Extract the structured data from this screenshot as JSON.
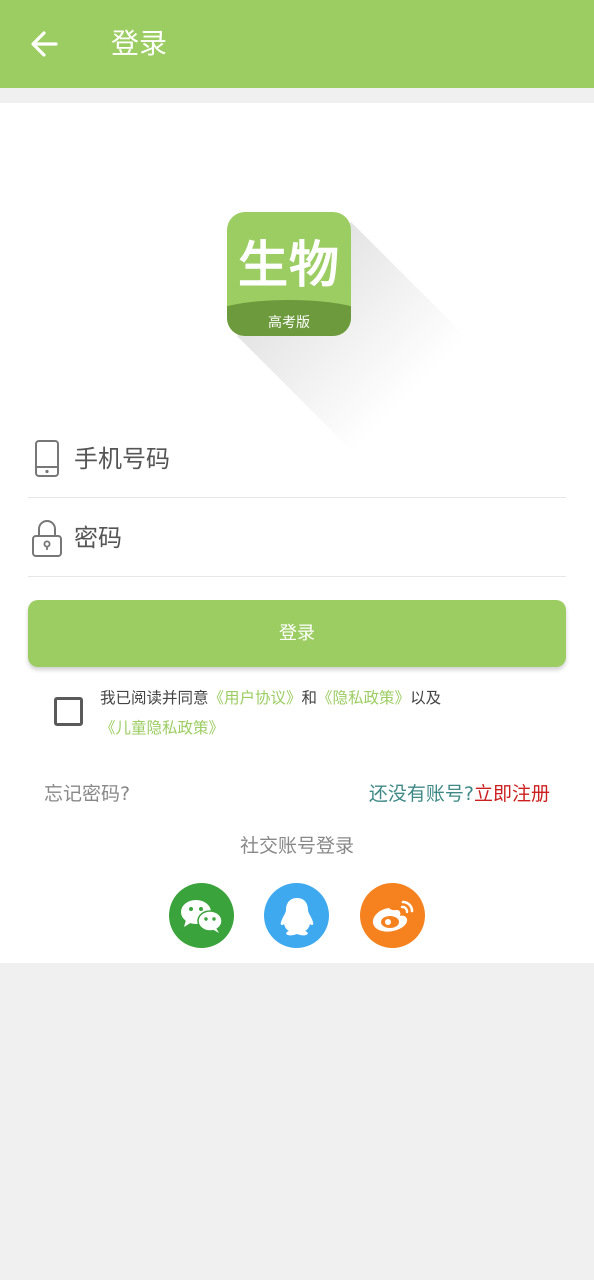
{
  "appbar": {
    "title": "登录",
    "back_icon": "arrow-left-icon"
  },
  "logo": {
    "main_text": "生物",
    "sub_text": "高考版",
    "brand_color": "#9ccd62",
    "band_color": "#6c9a3c"
  },
  "form": {
    "phone": {
      "placeholder": "手机号码",
      "icon": "phone-icon"
    },
    "password": {
      "placeholder": "密码",
      "icon": "lock-icon"
    },
    "login_button": "登录"
  },
  "agreement": {
    "checked": false,
    "prefix": "我已阅读并同意",
    "user_agreement": "《用户协议》",
    "and": "和",
    "privacy_policy": "《隐私政策》",
    "also": "以及",
    "child_privacy": "《儿童隐私政策》"
  },
  "links": {
    "forgot_password": "忘记密码?",
    "no_account": "还没有账号?",
    "register": "立即注册"
  },
  "social": {
    "title": "社交账号登录",
    "items": [
      {
        "icon": "wechat-icon",
        "color": "#3aa33b"
      },
      {
        "icon": "qq-icon",
        "color": "#3fa9f0"
      },
      {
        "icon": "weibo-icon",
        "color": "#f5821f"
      }
    ]
  }
}
